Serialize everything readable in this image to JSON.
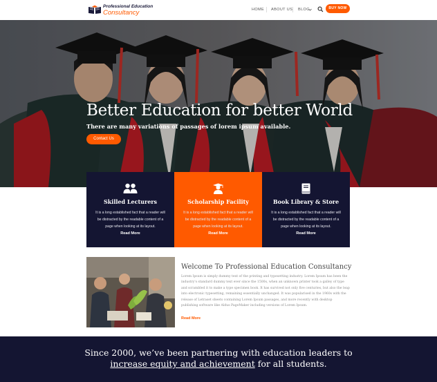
{
  "colors": {
    "accent": "#ff5a00",
    "navy": "#141532",
    "white": "#ffffff"
  },
  "header": {
    "logo_line1": "Professional Education",
    "logo_line2": "Consultancy",
    "nav": [
      {
        "label": "HOME"
      },
      {
        "label": "ABOUT US"
      },
      {
        "label": "BLOG"
      }
    ],
    "buy_label": "BUY NOW",
    "search_icon": "search-icon"
  },
  "hero": {
    "title": "Better Education for better World",
    "subtitle": "There are many variations of passages of lorem ipsum available.",
    "button": "Contact Us"
  },
  "features": [
    {
      "icon": "users-icon",
      "title": "Skilled Lecturers",
      "text": "It is a long established fact that a reader will be distracted by the readable content of a page when looking at its layout.",
      "more": "Read More"
    },
    {
      "icon": "graduate-icon",
      "title": "Scholarship Facility",
      "text": "It is a long established fact that a reader will be distracted by the readable content of a page when looking at its layout.",
      "more": "Read More"
    },
    {
      "icon": "book-icon",
      "title": "Book Library & Store",
      "text": "It is a long established fact that a reader will be distracted by the readable content of a page when looking at its layout.",
      "more": "Read More"
    }
  ],
  "welcome": {
    "title": "Welcome To Professional Education Consultancy",
    "text": "Lorem Ipsum is simply dummy text of the printing and typesetting industry. Lorem Ipsum has been the industry's standard dummy text ever since the 1500s, when an unknown printer took a galley of type and scrambled it to make a type specimen book. It has survived not only five centuries, but also the leap into electronic typesetting, remaining essentially unchanged. It was popularised in the 1960s with the release of Letraset sheets containing Lorem Ipsum passages, and more recently with desktop publishing software like Aldus PageMaker including versions of Lorem Ipsum.",
    "more": "Read More"
  },
  "band": {
    "line1": "Since 2000, we’ve been partnering with education leaders to",
    "line2_underlined": "increase equity and achievement",
    "line2_rest": " for all students."
  }
}
